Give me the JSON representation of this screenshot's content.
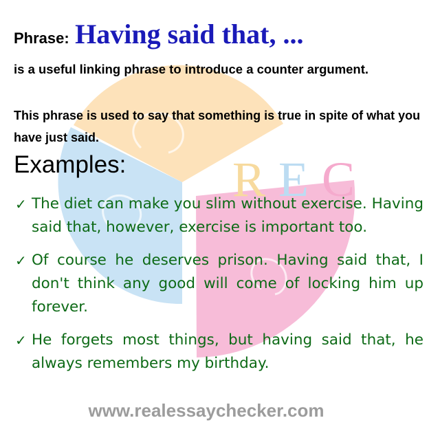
{
  "header": {
    "label": "Phrase:",
    "phrase": "Having said that, ..."
  },
  "description": {
    "line1": "is a useful linking phrase to introduce a counter argument.",
    "line2": "This phrase is used to say that something is true in spite of what you have just said."
  },
  "examples": {
    "heading": "Examples:",
    "items": [
      {
        "text": "The diet can make you slim without exercise. Having said that, however, exercise is important too."
      },
      {
        "text": "Of course he deserves prison. Having said that, I don't think any good will come of locking him up forever."
      },
      {
        "text": "He forgets most things, but having said that, he always remembers my birthday."
      }
    ]
  },
  "footer": {
    "url": "www.realessaychecker.com"
  },
  "logo": {
    "letters": [
      "R",
      "E",
      "C"
    ],
    "colors": {
      "orange": "#fde2ba",
      "blue": "#c9e3f5",
      "pink": "#f7bcd8",
      "letter_r": "#f7da9e",
      "letter_e": "#bcdcf2",
      "letter_c": "#f5aacd"
    }
  },
  "colors": {
    "phrase": "#1a1ab8",
    "example_text": "#0d6a16",
    "footer": "#9c9c9c"
  },
  "icons": {
    "check": "checkmark-icon"
  }
}
